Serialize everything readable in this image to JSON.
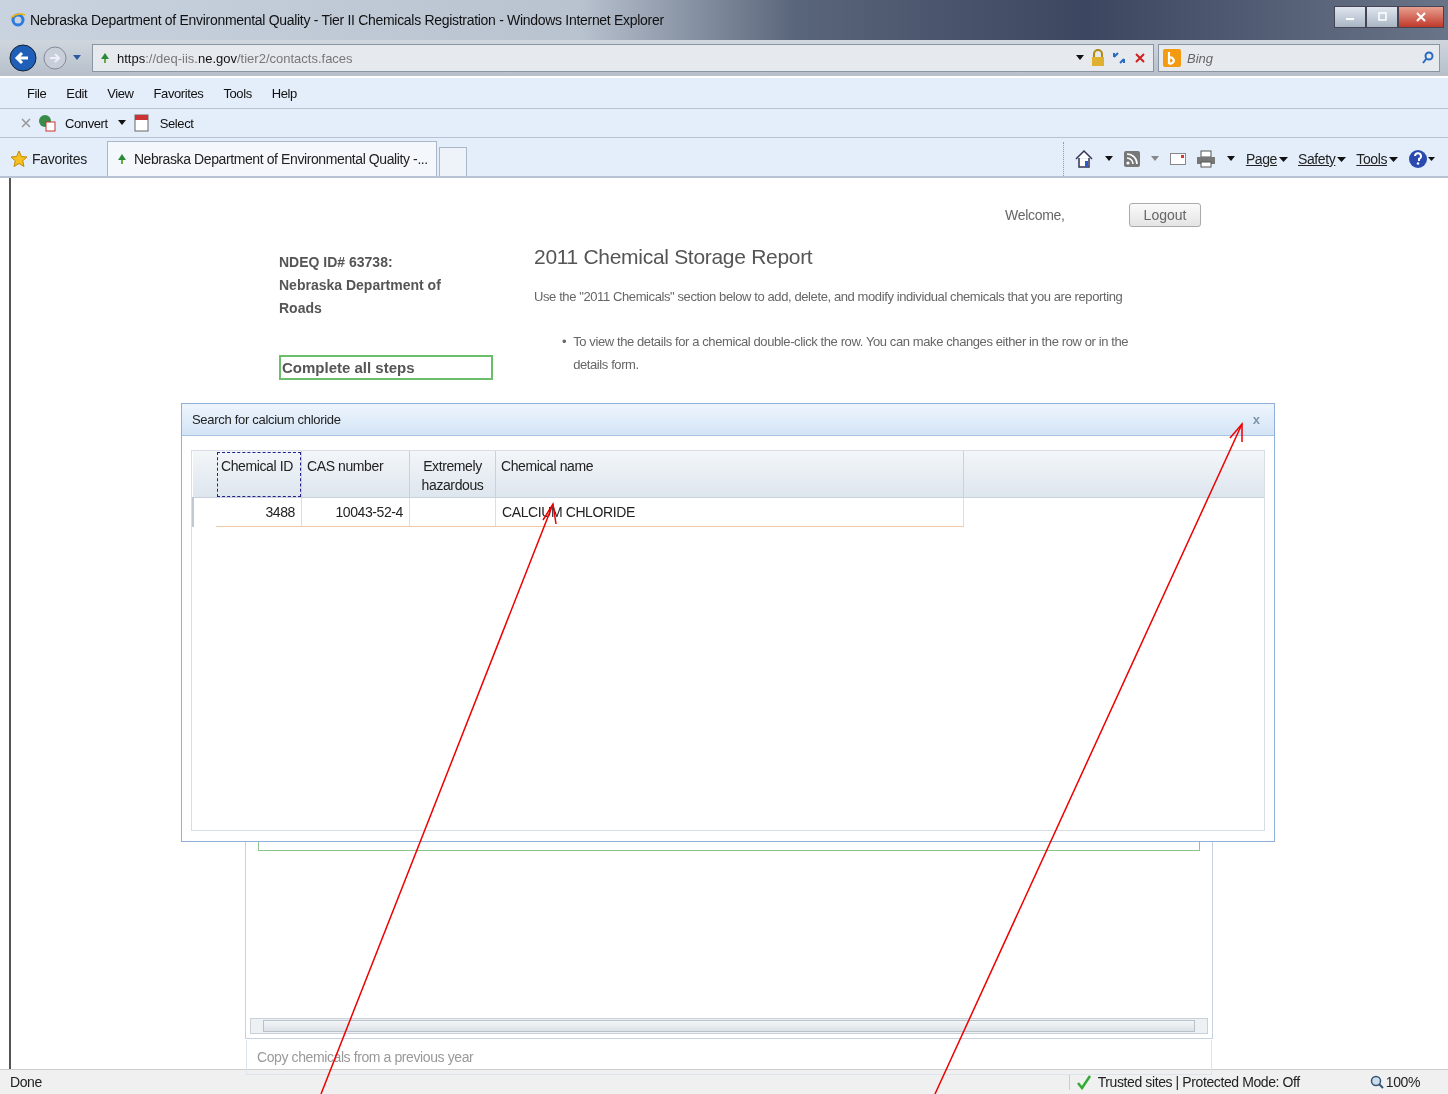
{
  "window": {
    "title": "Nebraska Department of Environmental Quality - Tier II Chemicals Registration - Windows Internet Explorer"
  },
  "address_bar": {
    "url": "**https**://deq-iis.**ne.gov**/tier2/contacts.faces"
  },
  "search": {
    "placeholder": "Bing"
  },
  "menu": [
    "File",
    "Edit",
    "View",
    "Favorites",
    "Tools",
    "Help"
  ],
  "toolbar": [
    "Convert",
    "Select"
  ],
  "favorites_bar": {
    "label": "Favorites",
    "tab": "Nebraska Department of Environmental Quality -..."
  },
  "command_bar": [
    "Page",
    "Safety",
    "Tools"
  ],
  "page": {
    "welcome": "Welcome,",
    "logout": "Logout",
    "facility": "NDEQ ID# 63738: Nebraska Department of Roads",
    "title": "2011 Chemical Storage Report",
    "intro": "Use the \"2011 Chemicals\" section below to add, delete, and modify individual chemicals that you are reporting",
    "bullets": [
      {
        "marker": "•",
        "text": "To view the details for a chemical double-click the row.  You can make changes either in the row or in the details form."
      }
    ],
    "steps_button": "Complete all steps",
    "copy_link": "Copy chemicals from a previous year"
  },
  "dialog": {
    "title": "Search for calcium chloride",
    "close": "x",
    "columns": [
      {
        "label": "Chemical ID",
        "focused": true
      },
      {
        "label": "CAS number",
        "focused": false
      },
      {
        "label": "Extremely hazardous",
        "focused": false
      },
      {
        "label": "Chemical name",
        "focused": false
      }
    ],
    "rows": [
      {
        "cells": [
          "3488",
          "10043-52-4",
          "",
          "CALCIUM CHLORIDE"
        ]
      }
    ]
  },
  "status_bar": {
    "text": "Done",
    "zone": "Trusted sites | Protected Mode: Off",
    "zoom": "100%"
  }
}
